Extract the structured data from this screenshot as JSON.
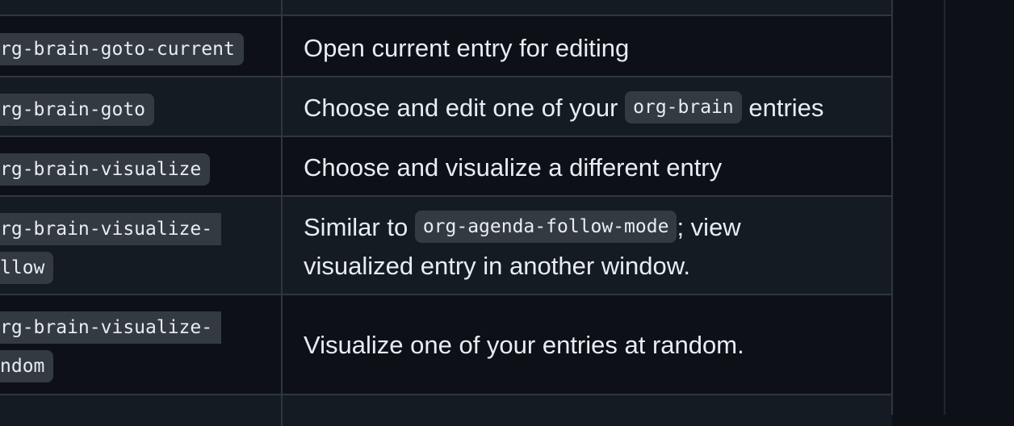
{
  "rows": [
    {
      "command": "",
      "description": ""
    },
    {
      "command": "rg-brain-goto-current",
      "description": "Open current entry for editing"
    },
    {
      "command": "rg-brain-goto",
      "description_before": "Choose and edit one of your ",
      "description_code": "org-brain",
      "description_after": " entries"
    },
    {
      "command": "rg-brain-visualize",
      "description": "Choose and visualize a different entry"
    },
    {
      "command_line1": "rg-brain-visualize-",
      "command_line2": "llow",
      "description_before": "Similar to ",
      "description_code": "org-agenda-follow-mode",
      "description_after": "; view",
      "description_line2": "visualized entry in another window."
    },
    {
      "command_line1": "rg-brain-visualize-",
      "command_line2": "ndom",
      "description": "Visualize one of your entries at random."
    }
  ]
}
